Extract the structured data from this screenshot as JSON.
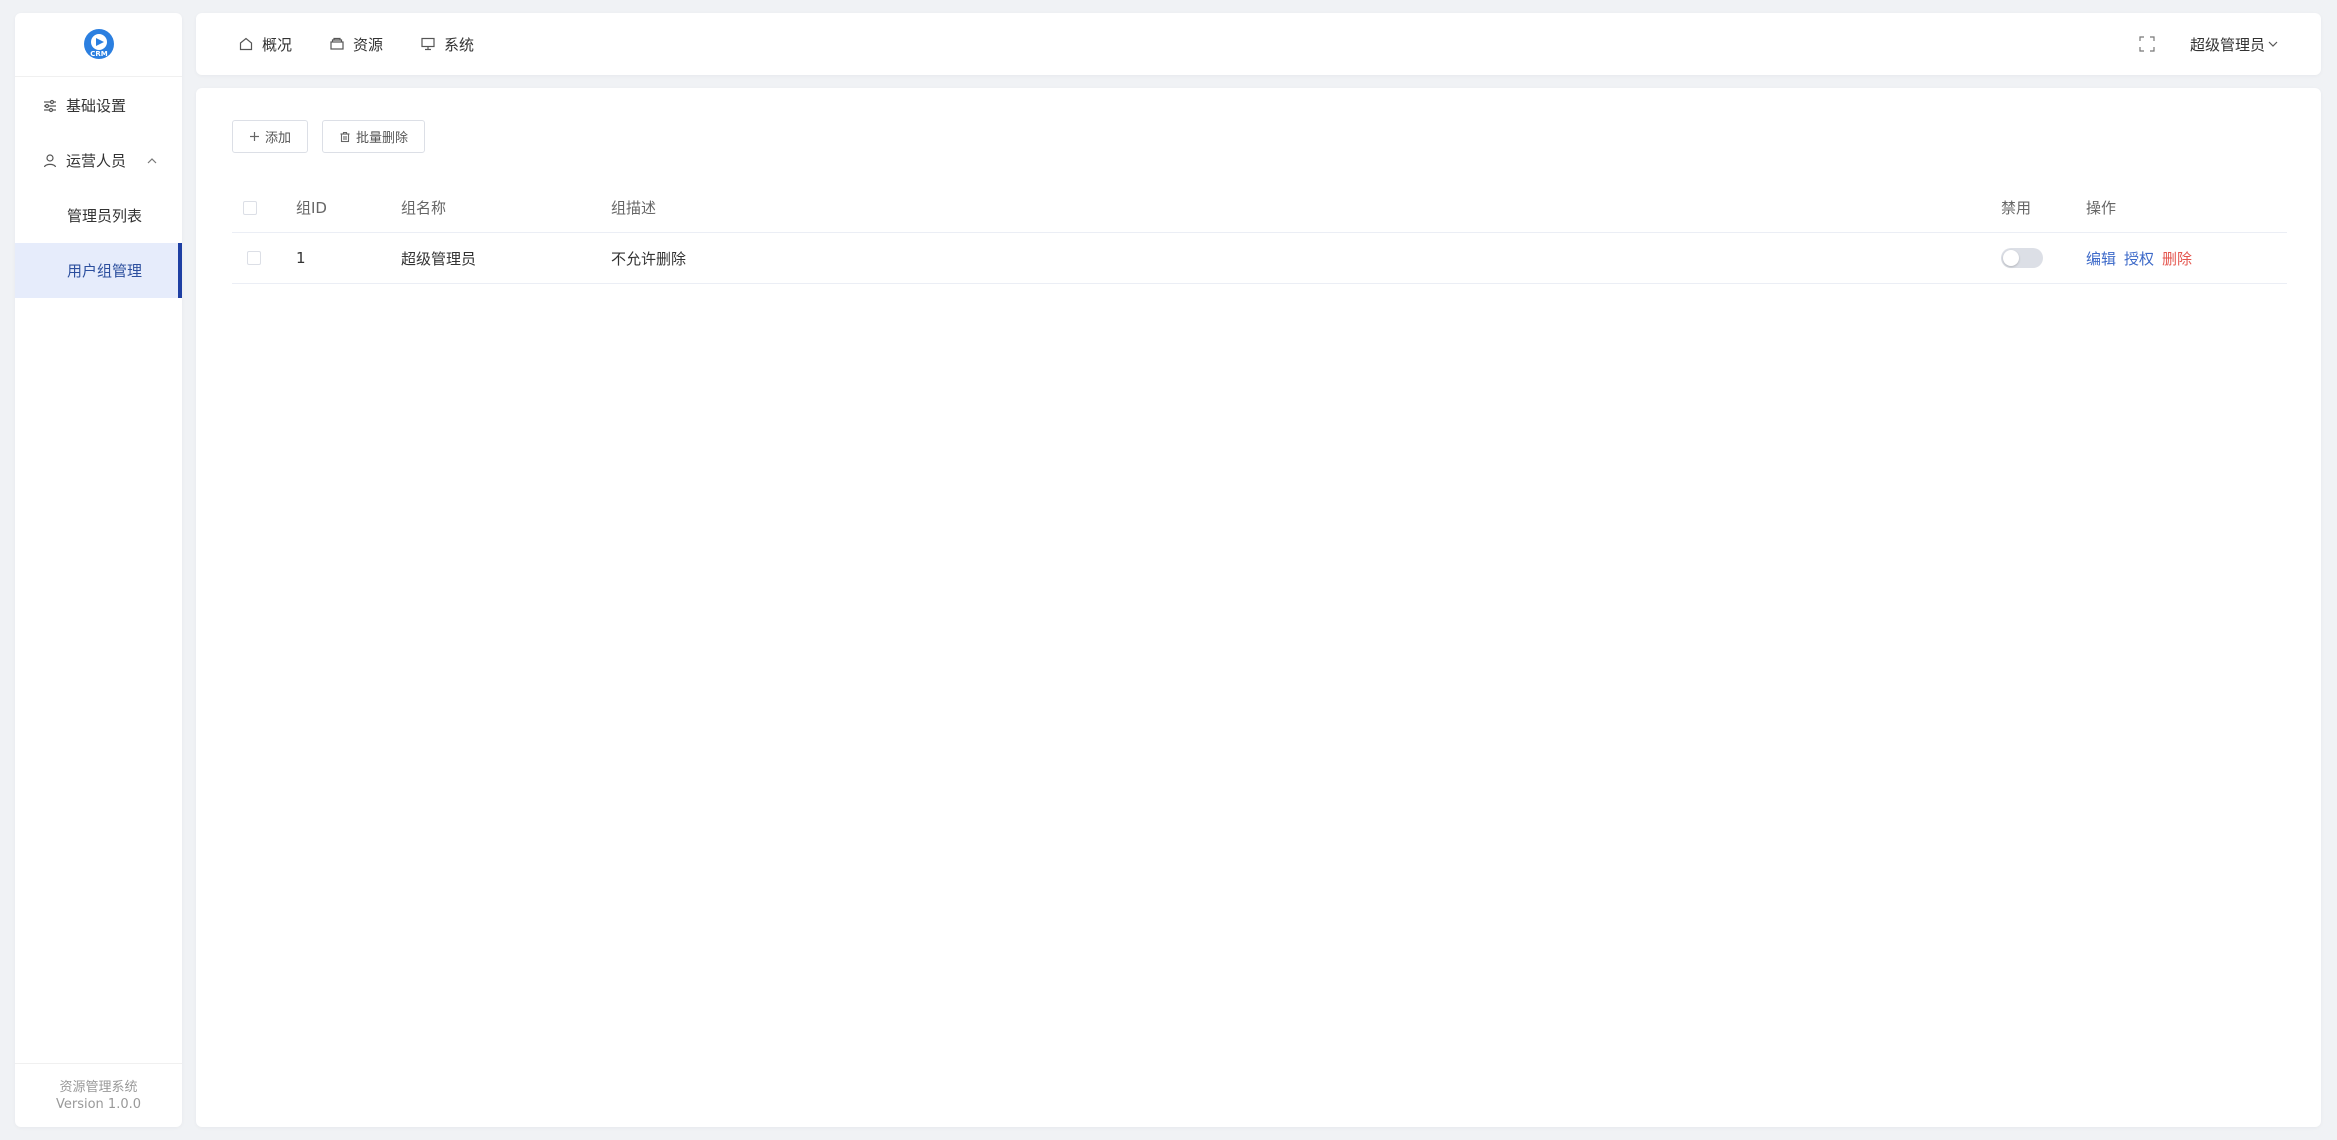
{
  "colors": {
    "brand": "#2b7fe0",
    "active_menu_bg": "#e6ecfb",
    "active_menu_border": "#1e3fa3",
    "link_blue": "#3d6ac9",
    "link_red": "#e4554e"
  },
  "sidebar": {
    "logo_text": "CRM",
    "items": [
      {
        "label": "基础设置",
        "icon": "sliders-icon"
      },
      {
        "label": "运营人员",
        "icon": "user-icon",
        "expanded": true,
        "children": [
          {
            "label": "管理员列表"
          },
          {
            "label": "用户组管理",
            "active": true
          }
        ]
      }
    ],
    "footer": {
      "line1": "资源管理系统",
      "line2": "Version 1.0.0"
    }
  },
  "header": {
    "nav": [
      {
        "label": "概况",
        "icon": "home-icon"
      },
      {
        "label": "资源",
        "icon": "layers-icon"
      },
      {
        "label": "系统",
        "icon": "monitor-icon"
      }
    ],
    "user": {
      "label": "超级管理员",
      "icon": "chevron-down-icon"
    },
    "fullscreen_icon": "fullscreen-icon"
  },
  "toolbar": {
    "add_label": "添加",
    "batch_delete_label": "批量删除"
  },
  "table": {
    "columns": [
      "组ID",
      "组名称",
      "组描述",
      "禁用",
      "操作"
    ],
    "rows": [
      {
        "id": "1",
        "name": "超级管理员",
        "desc": "不允许删除",
        "disabled": false
      }
    ],
    "actions": {
      "edit": "编辑",
      "grant": "授权",
      "delete": "删除"
    }
  }
}
